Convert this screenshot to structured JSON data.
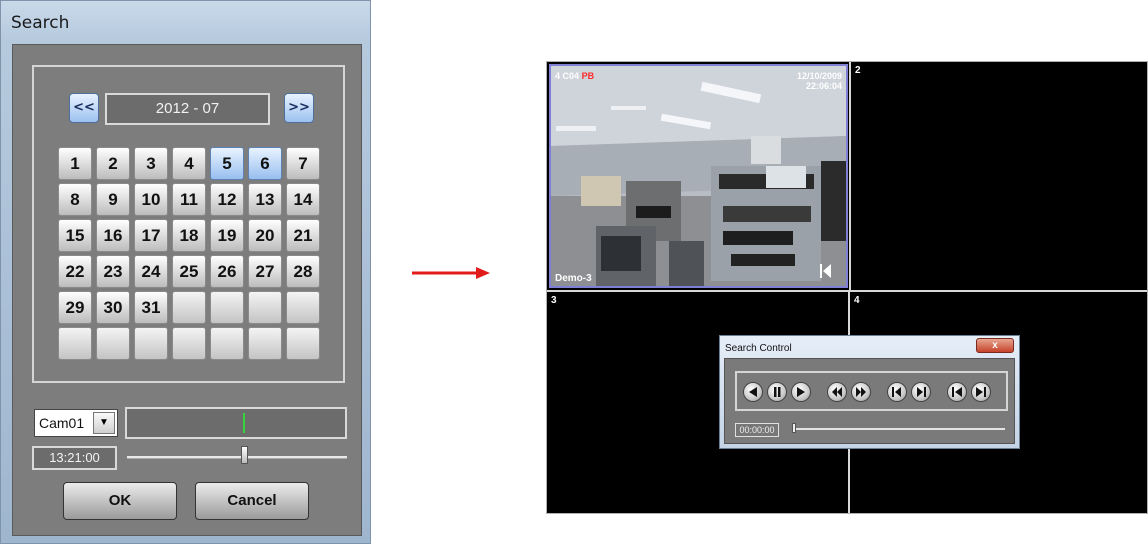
{
  "search_dialog": {
    "title": "Search",
    "month": "2012 - 07",
    "prev_label": "<<",
    "next_label": ">>",
    "days": [
      {
        "label": "1",
        "rec": false
      },
      {
        "label": "2",
        "rec": false
      },
      {
        "label": "3",
        "rec": false
      },
      {
        "label": "4",
        "rec": false
      },
      {
        "label": "5",
        "rec": true
      },
      {
        "label": "6",
        "rec": true
      },
      {
        "label": "7",
        "rec": false
      },
      {
        "label": "8",
        "rec": false
      },
      {
        "label": "9",
        "rec": false
      },
      {
        "label": "10",
        "rec": false
      },
      {
        "label": "11",
        "rec": false
      },
      {
        "label": "12",
        "rec": false
      },
      {
        "label": "13",
        "rec": false
      },
      {
        "label": "14",
        "rec": false
      },
      {
        "label": "15",
        "rec": false
      },
      {
        "label": "16",
        "rec": false
      },
      {
        "label": "17",
        "rec": false
      },
      {
        "label": "18",
        "rec": false
      },
      {
        "label": "19",
        "rec": false
      },
      {
        "label": "20",
        "rec": false
      },
      {
        "label": "21",
        "rec": false
      },
      {
        "label": "22",
        "rec": false
      },
      {
        "label": "23",
        "rec": false
      },
      {
        "label": "24",
        "rec": false
      },
      {
        "label": "25",
        "rec": false
      },
      {
        "label": "26",
        "rec": false
      },
      {
        "label": "27",
        "rec": false
      },
      {
        "label": "28",
        "rec": false
      },
      {
        "label": "29",
        "rec": false
      },
      {
        "label": "30",
        "rec": false
      },
      {
        "label": "31",
        "rec": false
      },
      {
        "label": "",
        "rec": false
      },
      {
        "label": "",
        "rec": false
      },
      {
        "label": "",
        "rec": false
      },
      {
        "label": "",
        "rec": false
      },
      {
        "label": "",
        "rec": false
      },
      {
        "label": "",
        "rec": false
      },
      {
        "label": "",
        "rec": false
      },
      {
        "label": "",
        "rec": false
      },
      {
        "label": "",
        "rec": false
      },
      {
        "label": "",
        "rec": false
      },
      {
        "label": "",
        "rec": false
      }
    ],
    "camera": "Cam01",
    "time": "13:21:00",
    "time_slider_value": 0.53,
    "timeline_marker_value": 0.53,
    "ok_label": "OK",
    "cancel_label": "Cancel",
    "record_day_color": "#98bfef",
    "timeline_marker_color": "#36d43c"
  },
  "arrow_color": "#e21b1b",
  "monitor": {
    "channels": [
      {
        "num": "4",
        "label": "C04",
        "tag": "PB",
        "date": "12/10/2009",
        "clock": "22:06:04",
        "caption": "Demo-3"
      },
      {
        "num": "2"
      },
      {
        "num": "3"
      },
      {
        "num": "4"
      }
    ],
    "active_border_color": "#7f7fd4"
  },
  "search_control": {
    "title": "Search Control",
    "close_label": "x",
    "time": "00:00:00",
    "buttons": [
      "play-reverse-icon",
      "pause-icon",
      "play-forward-icon",
      "rewind-icon",
      "fast-forward-icon",
      "step-back-icon",
      "step-forward-icon",
      "skip-to-start-icon",
      "skip-to-end-icon"
    ]
  }
}
